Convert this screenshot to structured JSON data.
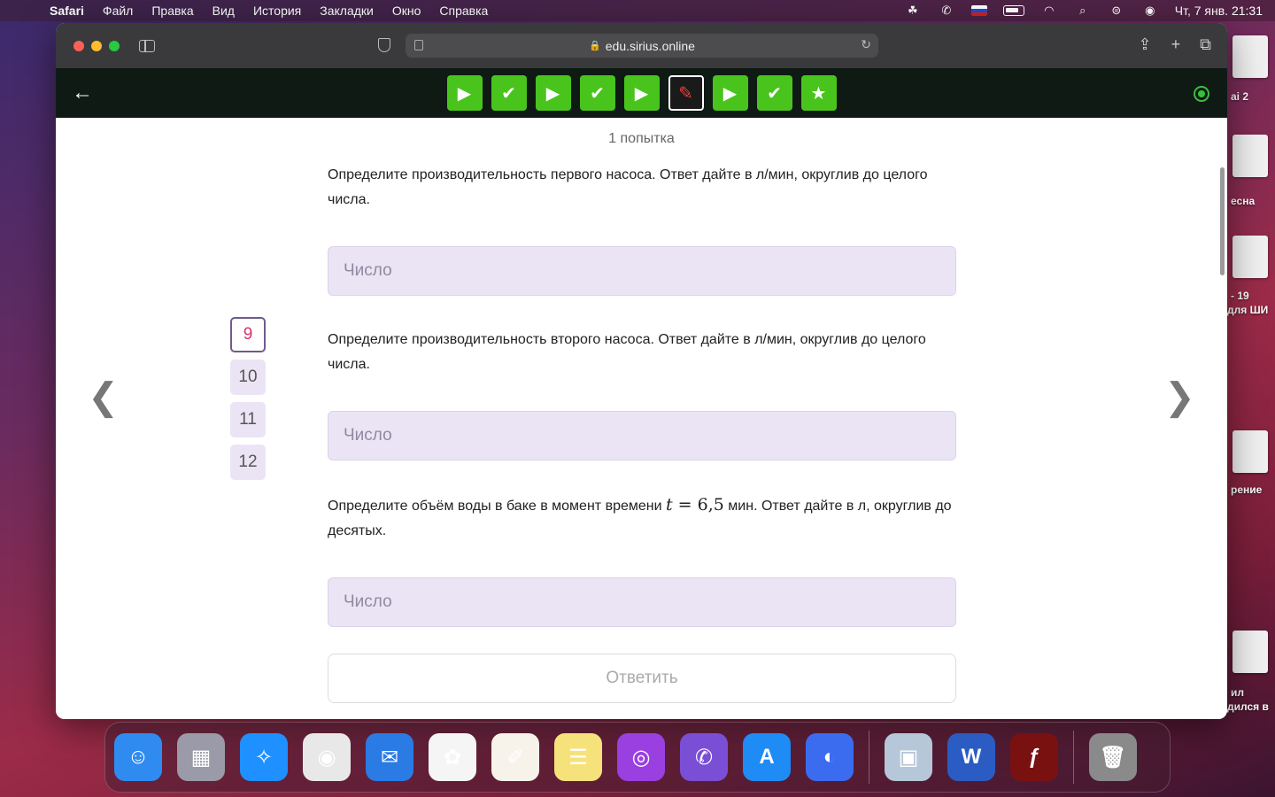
{
  "menubar": {
    "app_name": "Safari",
    "items": [
      "Файл",
      "Правка",
      "Вид",
      "История",
      "Закладки",
      "Окно",
      "Справка"
    ],
    "datetime": "Чт, 7 янв.  21:31"
  },
  "desktop": {
    "labels": [
      "ai 2",
      "есна",
      "- 19",
      "для ШИ",
      "рение",
      "ил",
      "дился в"
    ]
  },
  "browser": {
    "url": "edu.sirius.online"
  },
  "app": {
    "nav_tiles": [
      {
        "type": "play",
        "icon": "play-icon",
        "glyph": "▶"
      },
      {
        "type": "done",
        "icon": "check-icon",
        "glyph": "✔"
      },
      {
        "type": "play",
        "icon": "play-icon",
        "glyph": "▶"
      },
      {
        "type": "done",
        "icon": "check-icon",
        "glyph": "✔"
      },
      {
        "type": "play",
        "icon": "play-icon",
        "glyph": "▶"
      },
      {
        "type": "current",
        "icon": "pencil-icon",
        "glyph": "✎"
      },
      {
        "type": "play",
        "icon": "play-icon",
        "glyph": "▶"
      },
      {
        "type": "done",
        "icon": "check-icon",
        "glyph": "✔"
      },
      {
        "type": "star",
        "icon": "star-icon",
        "glyph": "★"
      }
    ],
    "accent_color": "#49c41c"
  },
  "content": {
    "attempt_label": "1 попытка",
    "question_numbers": [
      {
        "label": "9",
        "active": true
      },
      {
        "label": "10",
        "active": false
      },
      {
        "label": "11",
        "active": false
      },
      {
        "label": "12",
        "active": false
      }
    ],
    "questions": [
      {
        "text": "Определите производительность первого насоса. Ответ дайте в л/мин, округлив до целого числа.",
        "placeholder": "Число"
      },
      {
        "text": "Определите производительность второго насоса. Ответ дайте в л/мин, округлив до целого числа.",
        "placeholder": "Число"
      },
      {
        "text_before": "Определите объём воды в баке в момент времени ",
        "math_var": "t",
        "math_rest": " = 6,5",
        "text_after": " мин. Ответ дайте в л, округлив до десятых.",
        "placeholder": "Число"
      }
    ],
    "submit_label": "Ответить"
  },
  "dock": {
    "apps": [
      {
        "name": "finder",
        "bg": "#2f8bf0",
        "glyph": "☺"
      },
      {
        "name": "launchpad",
        "bg": "#9a9aa8",
        "glyph": "▦"
      },
      {
        "name": "safari",
        "bg": "#1e90ff",
        "glyph": "✧"
      },
      {
        "name": "chrome",
        "bg": "#e8e8e8",
        "glyph": "◉"
      },
      {
        "name": "mail",
        "bg": "#2a7be4",
        "glyph": "✉"
      },
      {
        "name": "photos",
        "bg": "#f5f5f5",
        "glyph": "✿"
      },
      {
        "name": "pages",
        "bg": "#f7f3ea",
        "glyph": "✐"
      },
      {
        "name": "notes",
        "bg": "#f6e27a",
        "glyph": "☰"
      },
      {
        "name": "podcasts",
        "bg": "#9a3fe0",
        "glyph": "◎"
      },
      {
        "name": "viber",
        "bg": "#7a4fd6",
        "glyph": "✆"
      },
      {
        "name": "app-store",
        "bg": "#1f8bf5",
        "glyph": "A"
      },
      {
        "name": "yandex",
        "bg": "#3b6cf0",
        "glyph": "◐"
      },
      {
        "name": "preview",
        "bg": "#b6c7d9",
        "glyph": "▣"
      },
      {
        "name": "word",
        "bg": "#2b5cc4",
        "glyph": "W"
      },
      {
        "name": "flash",
        "bg": "#7a1111",
        "glyph": "ƒ"
      },
      {
        "name": "trash",
        "bg": "#8a8a8a",
        "glyph": "🗑"
      }
    ]
  }
}
